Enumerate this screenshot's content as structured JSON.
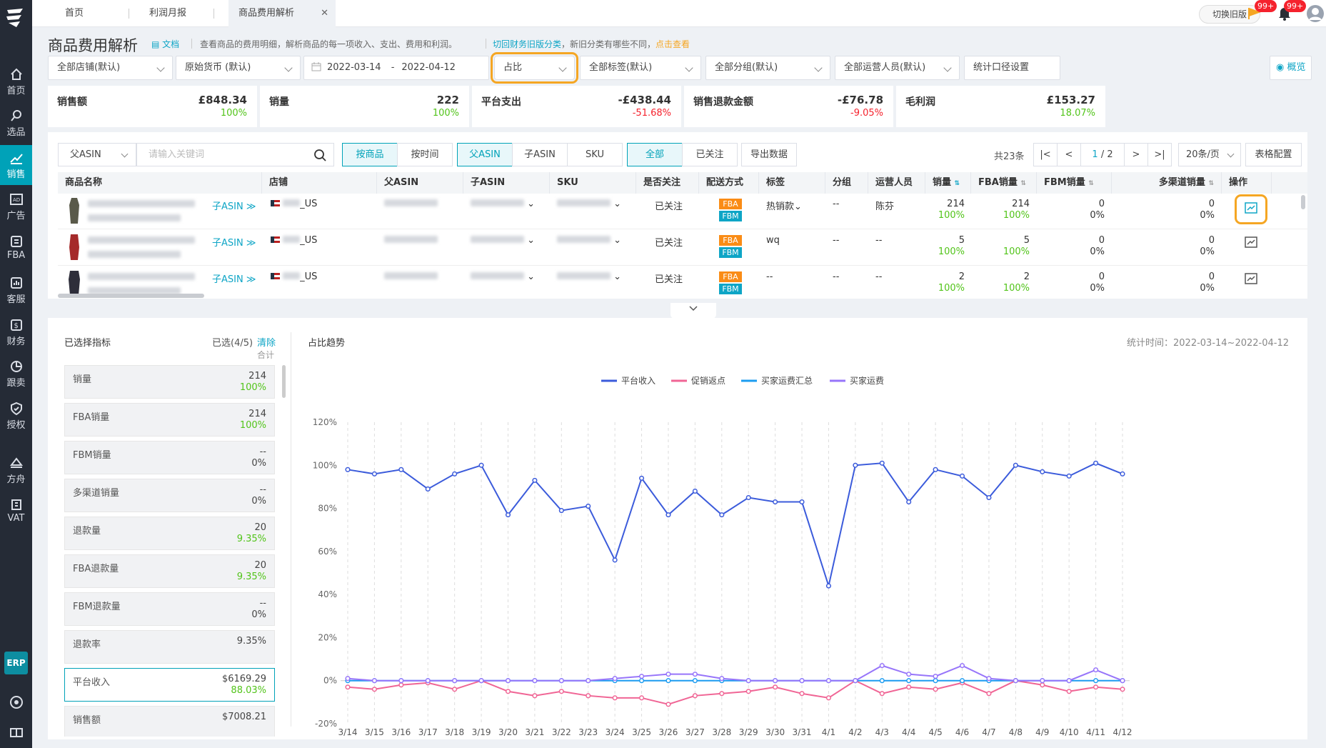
{
  "sidebar": {
    "items": [
      "首页",
      "选品",
      "销售",
      "广告",
      "FBA",
      "客服",
      "财务",
      "跟卖",
      "授权",
      "方舟",
      "VAT"
    ],
    "erp": "ERP"
  },
  "tabs": [
    "首页",
    "利润月报",
    "商品费用解析"
  ],
  "topbar": {
    "old_version": "切换旧版",
    "notif_badge": "99+",
    "msg_badge": "99+"
  },
  "header": {
    "title": "商品费用解析",
    "doc": "文档",
    "desc": "查看商品的费用明细，解析商品的每一项收入、支出、费用和利润。",
    "link1": "切回财务旧版分类",
    "desc2": "，新旧分类有哪些不同，",
    "link2": "点击查看",
    "overview": "概览"
  },
  "filters": {
    "store": "全部店铺(默认)",
    "currency": "原始货币 (默认)",
    "date_from": "2022-03-14",
    "date_sep": "-",
    "date_to": "2022-04-12",
    "display": "占比",
    "tag": "全部标签(默认)",
    "group": "全部分组(默认)",
    "operator": "全部运营人员(默认)",
    "stat": "统计口径设置"
  },
  "kpis": [
    {
      "label": "销售额",
      "value": "£848.34",
      "pct": "100%"
    },
    {
      "label": "销量",
      "value": "222",
      "pct": "100%"
    },
    {
      "label": "平台支出",
      "value": "-£438.44",
      "pct": "-51.68%"
    },
    {
      "label": "销售退款金额",
      "value": "-£76.78",
      "pct": "-9.05%"
    },
    {
      "label": "毛利润",
      "value": "£153.27",
      "pct": "18.07%"
    }
  ],
  "table_ctrl": {
    "asin_select": "父ASIN",
    "search_placeholder": "请输入关键词",
    "by_product": "按商品",
    "by_time": "按时间",
    "parent_asin": "父ASIN",
    "child_asin": "子ASIN",
    "sku": "SKU",
    "all": "全部",
    "followed": "已关注",
    "export": "导出数据",
    "total": "共23条",
    "page": "1",
    "pages": "/ 2",
    "per_page": "20条/页",
    "config": "表格配置"
  },
  "columns": [
    "商品名称",
    "店铺",
    "父ASIN",
    "子ASIN",
    "SKU",
    "是否关注",
    "配送方式",
    "标签",
    "分组",
    "运营人员",
    "销量",
    "FBA销量",
    "FBM销量",
    "多渠道销量",
    "操作"
  ],
  "rows": [
    {
      "child_link": "子ASIN",
      "store": "_US",
      "follow": "已关注",
      "fba": "FBA",
      "fbm": "FBM",
      "tag": "热销款",
      "group": "--",
      "operator": "陈芬",
      "sales": "214",
      "sales_pct": "100%",
      "fba_sales": "214",
      "fba_pct": "100%",
      "fbm_sales": "0",
      "fbm_pct": "0%",
      "multi": "0",
      "multi_pct": "0%"
    },
    {
      "child_link": "子ASIN",
      "store": "_US",
      "follow": "已关注",
      "fba": "FBA",
      "fbm": "FBM",
      "tag": "wq",
      "group": "--",
      "operator": "--",
      "sales": "5",
      "sales_pct": "100%",
      "fba_sales": "5",
      "fba_pct": "100%",
      "fbm_sales": "0",
      "fbm_pct": "0%",
      "multi": "0",
      "multi_pct": "0%"
    },
    {
      "child_link": "子ASIN",
      "store": "_US",
      "follow": "已关注",
      "fba": "FBA",
      "fbm": "FBM",
      "tag": "--",
      "group": "--",
      "operator": "--",
      "sales": "2",
      "sales_pct": "100%",
      "fba_sales": "2",
      "fba_pct": "100%",
      "fbm_sales": "0",
      "fbm_pct": "0%",
      "multi": "0",
      "multi_pct": "0%"
    }
  ],
  "metrics_panel": {
    "title": "已选择指标",
    "selected": "已选(4/5)",
    "clear": "清除",
    "total": "合计",
    "items": [
      {
        "name": "销量",
        "value": "214",
        "pct": "100%"
      },
      {
        "name": "FBA销量",
        "value": "214",
        "pct": "100%"
      },
      {
        "name": "FBM销量",
        "value": "--",
        "pct": "0%"
      },
      {
        "name": "多渠道销量",
        "value": "--",
        "pct": "0%"
      },
      {
        "name": "退款量",
        "value": "20",
        "pct": "9.35%"
      },
      {
        "name": "FBA退款量",
        "value": "20",
        "pct": "9.35%"
      },
      {
        "name": "FBM退款量",
        "value": "--",
        "pct": "0%"
      },
      {
        "name": "退款率",
        "value": "9.35%",
        "pct": ""
      },
      {
        "name": "平台收入",
        "value": "$6169.29",
        "pct": "88.03%"
      },
      {
        "name": "销售额",
        "value": "$7008.21",
        "pct": ""
      }
    ]
  },
  "chart_title": "占比趋势",
  "stat_time": "统计时间：2022-03-14~2022-04-12",
  "chart_data": {
    "type": "line",
    "x": [
      "3/14",
      "3/15",
      "3/16",
      "3/17",
      "3/18",
      "3/19",
      "3/20",
      "3/21",
      "3/22",
      "3/23",
      "3/24",
      "3/25",
      "3/26",
      "3/27",
      "3/28",
      "3/29",
      "3/30",
      "3/31",
      "4/1",
      "4/2",
      "4/3",
      "4/4",
      "4/5",
      "4/6",
      "4/7",
      "4/8",
      "4/9",
      "4/10",
      "4/11",
      "4/12"
    ],
    "ylim": [
      -20,
      120
    ],
    "yticks": [
      "120%",
      "100%",
      "80%",
      "60%",
      "40%",
      "20%",
      "0%",
      "-20%"
    ],
    "series": [
      {
        "name": "平台收入",
        "color": "#3b5bdb",
        "values": [
          98,
          96,
          98,
          89,
          96,
          100,
          77,
          93,
          79,
          81,
          56,
          94,
          77,
          88,
          77,
          85,
          83,
          83,
          44,
          100,
          101,
          83,
          98,
          95,
          85,
          100,
          97,
          95,
          101,
          96
        ]
      },
      {
        "name": "促销返点",
        "color": "#f06595",
        "values": [
          -3,
          -4,
          -2,
          -1,
          -4,
          0,
          -5,
          -7,
          -5,
          -7,
          -8,
          -8,
          -11,
          -7,
          -6,
          -5,
          -3,
          -6,
          -8,
          0,
          -6,
          -3,
          -4,
          -1,
          -6,
          0,
          -2,
          -5,
          -3,
          -4
        ]
      },
      {
        "name": "买家运费汇总",
        "color": "#1c9cf0",
        "values": [
          0,
          0,
          0,
          0,
          0,
          0,
          0,
          0,
          0,
          0,
          0,
          0,
          0,
          0,
          0,
          0,
          0,
          0,
          0,
          0,
          0,
          0,
          0,
          0,
          0,
          0,
          0,
          0,
          0,
          0
        ]
      },
      {
        "name": "买家运费",
        "color": "#9775fa",
        "values": [
          1,
          0,
          0,
          0,
          0,
          0,
          0,
          0,
          0,
          0,
          1,
          2,
          3,
          3,
          1,
          0,
          0,
          0,
          0,
          0,
          7,
          3,
          2,
          7,
          1,
          0,
          0,
          0,
          5,
          0
        ]
      }
    ]
  }
}
